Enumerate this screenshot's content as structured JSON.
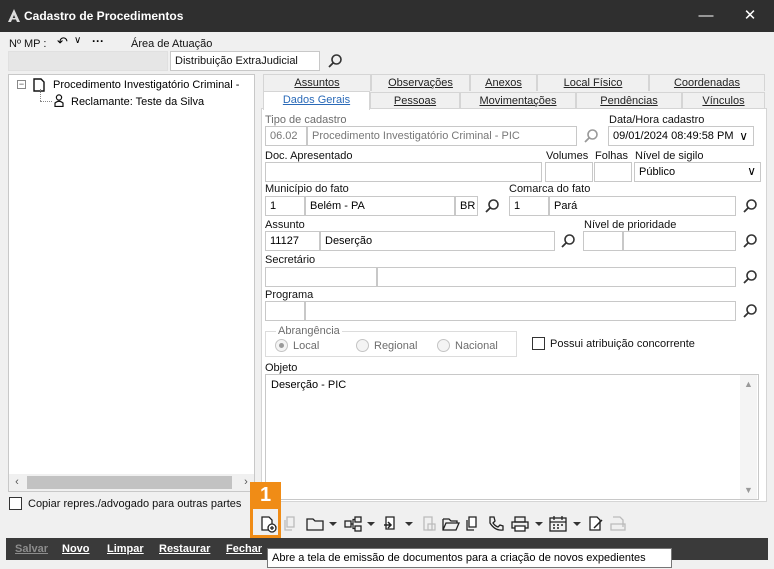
{
  "window": {
    "title": "Cadastro de Procedimentos",
    "minimize": "—",
    "close": "✕"
  },
  "header": {
    "mp_label": "Nº MP :",
    "area_label": "Área de Atuação",
    "area_value": "Distribuição ExtraJudicial"
  },
  "tree": {
    "nodes": [
      {
        "toggle": "−",
        "label": "Procedimento Investigatório Criminal -"
      },
      {
        "label": "Reclamante: Teste da Silva"
      }
    ]
  },
  "copy_checkbox": {
    "label": "Copiar repres./advogado para outras partes",
    "checked": false
  },
  "tabs": {
    "row1": [
      "Assuntos",
      "Observações",
      "Anexos",
      "Local Físico",
      "Coordenadas"
    ],
    "row2": [
      "Dados Gerais",
      "Pessoas",
      "Movimentações",
      "Pendências",
      "Vínculos"
    ],
    "active": "Dados Gerais"
  },
  "form": {
    "tipo_label": "Tipo de cadastro",
    "tipo_code": "06.02",
    "tipo_value": "Procedimento Investigatório Criminal - PIC",
    "data_label": "Data/Hora cadastro",
    "data_value": "09/01/2024 08:49:58 PM",
    "doc_label": "Doc. Apresentado",
    "volumes_label": "Volumes",
    "folhas_label": "Folhas",
    "sigilo_label": "Nível de sigilo",
    "sigilo_value": "Público",
    "municipio_label": "Município do fato",
    "municipio_code": "1",
    "municipio_value": "Belém - PA",
    "municipio_uf": "BR",
    "comarca_label": "Comarca do fato",
    "comarca_code": "1",
    "comarca_value": "Pará",
    "assunto_label": "Assunto",
    "assunto_code": "11127",
    "assunto_value": "Deserção",
    "prioridade_label": "Nível de prioridade",
    "secretario_label": "Secretário",
    "programa_label": "Programa",
    "abrangencia_label": "Abrangência",
    "abrangencia_options": [
      "Local",
      "Regional",
      "Nacional"
    ],
    "abrangencia_selected": "Local",
    "concorrente_label": "Possui atribuição concorrente",
    "objeto_label": "Objeto",
    "objeto_value": "Deserção - PIC"
  },
  "annotation_badge": "1",
  "actions": {
    "salvar": "Salvar",
    "novo": "Novo",
    "limpar": "Limpar",
    "restaurar": "Restaurar",
    "fechar": "Fechar"
  },
  "tooltip": "Abre a tela de emissão de documentos para a criação de novos expedientes",
  "colors": {
    "titlebar": "#2f2f2f",
    "active_tab": "#2a6ab8",
    "badge": "#f08c16",
    "actionbar": "#3a3a3a"
  }
}
